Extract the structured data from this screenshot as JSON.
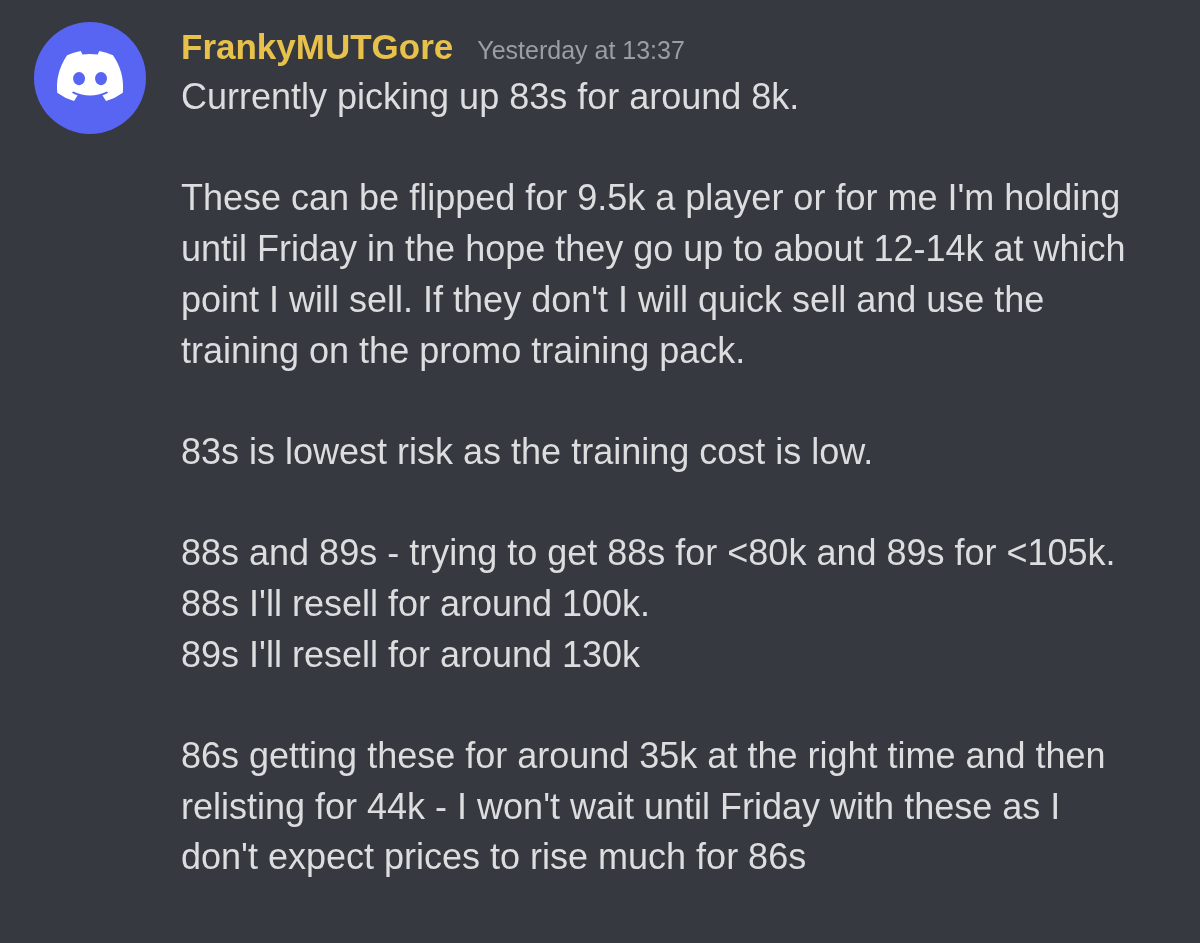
{
  "message": {
    "author": "FrankyMUTGore",
    "timestamp": "Yesterday at 13:37",
    "paragraphs": [
      [
        "Currently picking up 83s for around 8k."
      ],
      [
        "These can be flipped for 9.5k a player or for me I'm holding",
        "until Friday in the hope they go up to about 12-14k at which",
        "point I will sell. If they don't I will quick sell and use the",
        "training on the promo training pack."
      ],
      [
        "83s is lowest risk as the training cost is low."
      ],
      [
        "88s and 89s - trying to get 88s for <80k and 89s for <105k.",
        "88s I'll resell for around 100k.",
        "89s I'll resell for around 130k"
      ],
      [
        "86s getting these for around 35k at the right time and then",
        "relisting for 44k - I won't wait until Friday with these as I",
        "don't expect prices to rise much for 86s"
      ]
    ]
  }
}
